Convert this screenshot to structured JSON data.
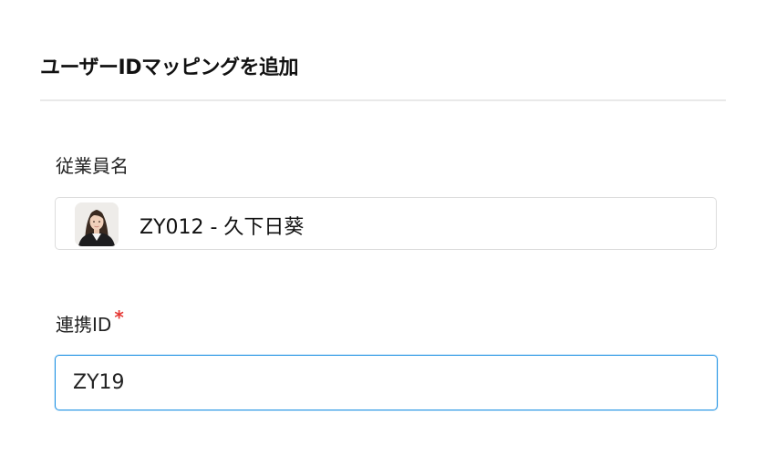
{
  "dialog": {
    "title": "ユーザーIDマッピングを追加"
  },
  "employee_field": {
    "label": "従業員名",
    "selected_value": "ZY012 - 久下日葵",
    "avatar_icon": "employee-photo"
  },
  "link_id_field": {
    "label": "連携ID",
    "required_mark": "*",
    "value": "ZY19"
  },
  "colors": {
    "focus_border": "#1a8fe3",
    "required": "#e53935",
    "divider": "#e9e9e9",
    "border": "#dcdcdc"
  }
}
